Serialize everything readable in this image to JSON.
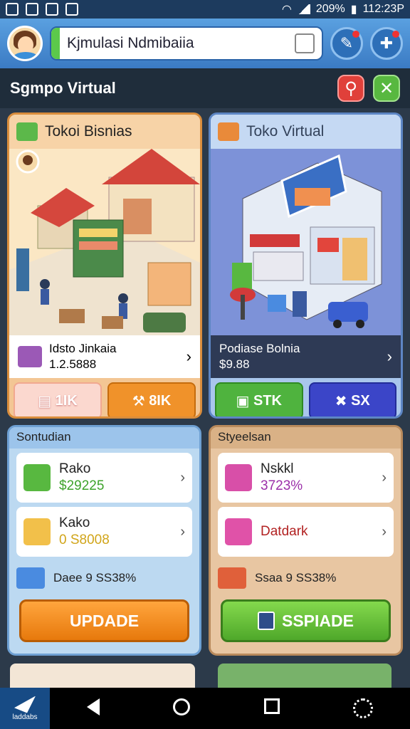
{
  "status": {
    "battery": "209%",
    "time": "112:23P"
  },
  "header": {
    "app_title": "Kjmulasi Ndmibaiia",
    "section_title": "Sgmpo Virtual"
  },
  "cards": [
    {
      "title": "Tokoi Bisnias",
      "info_title": "Idsto Jinkaia",
      "info_value": "1.2.5888",
      "btn1": "1IK",
      "btn2": "8IK"
    },
    {
      "title": "Toko Virtual",
      "info_title": "Podiase Bolnia",
      "info_value": "$9.88",
      "btn1": "STK",
      "btn2": "SX"
    }
  ],
  "panels": [
    {
      "title": "Sontudian",
      "items": [
        {
          "name": "Rako",
          "value": "$29225"
        },
        {
          "name": "Kako",
          "value": "0 S8008"
        }
      ],
      "footer": "Daee 9 SS38%",
      "button": "UPDADE"
    },
    {
      "title": "Styeelsan",
      "items": [
        {
          "name": "Nskkl",
          "value": "3723%"
        },
        {
          "name": "Datdark"
        }
      ],
      "footer": "Ssaa 9 SS38%",
      "button": "SSPIADE"
    }
  ],
  "nav": {
    "app_label": "laddabs"
  }
}
